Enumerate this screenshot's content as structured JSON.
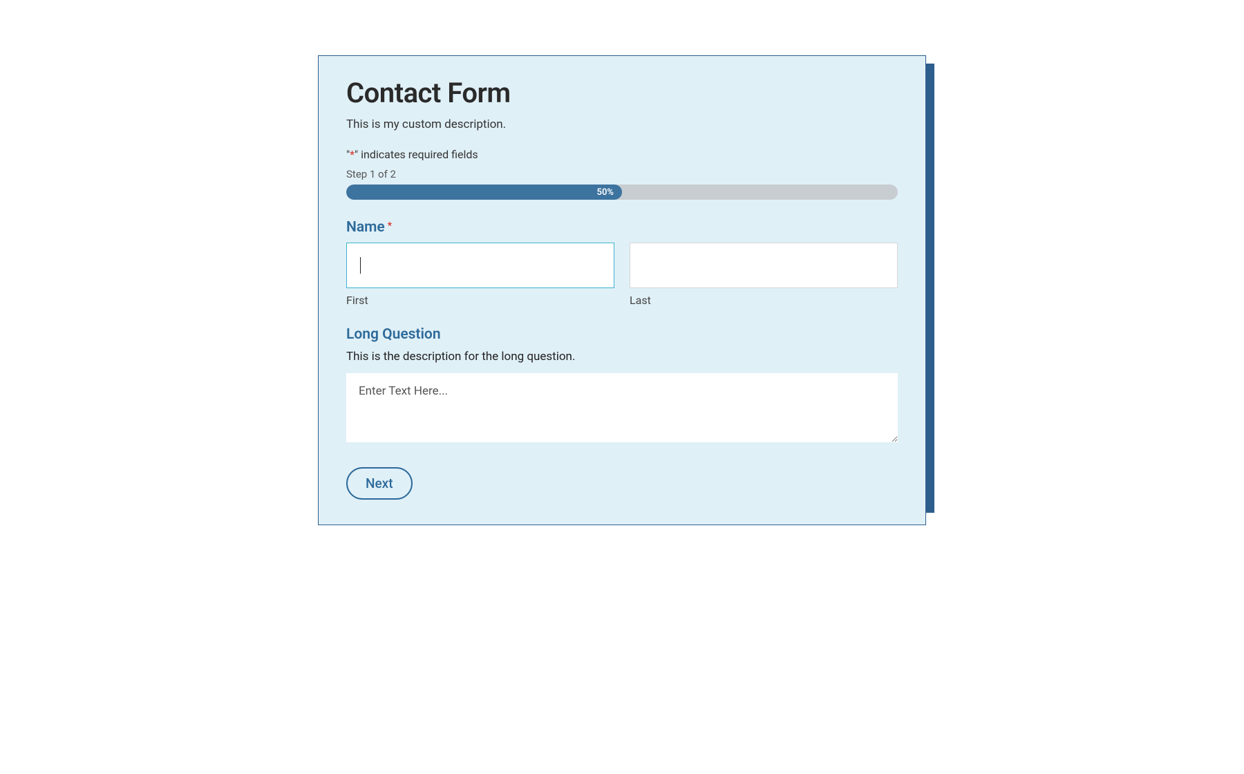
{
  "form": {
    "title": "Contact Form",
    "description": "This is my custom description.",
    "required_note_prefix": "\"",
    "required_note_asterisk": "*",
    "required_note_suffix": "\" indicates required fields",
    "step_label": "Step 1 of 2",
    "progress_percent_label": "50%",
    "progress_percent": 50,
    "fields": {
      "name": {
        "label": "Name",
        "required_marker": "*",
        "first": {
          "value": "",
          "sublabel": "First"
        },
        "last": {
          "value": "",
          "sublabel": "Last"
        }
      },
      "long_question": {
        "label": "Long Question",
        "description": "This is the description for the long question.",
        "placeholder": "Enter Text Here...",
        "value": ""
      }
    },
    "next_button": "Next"
  }
}
